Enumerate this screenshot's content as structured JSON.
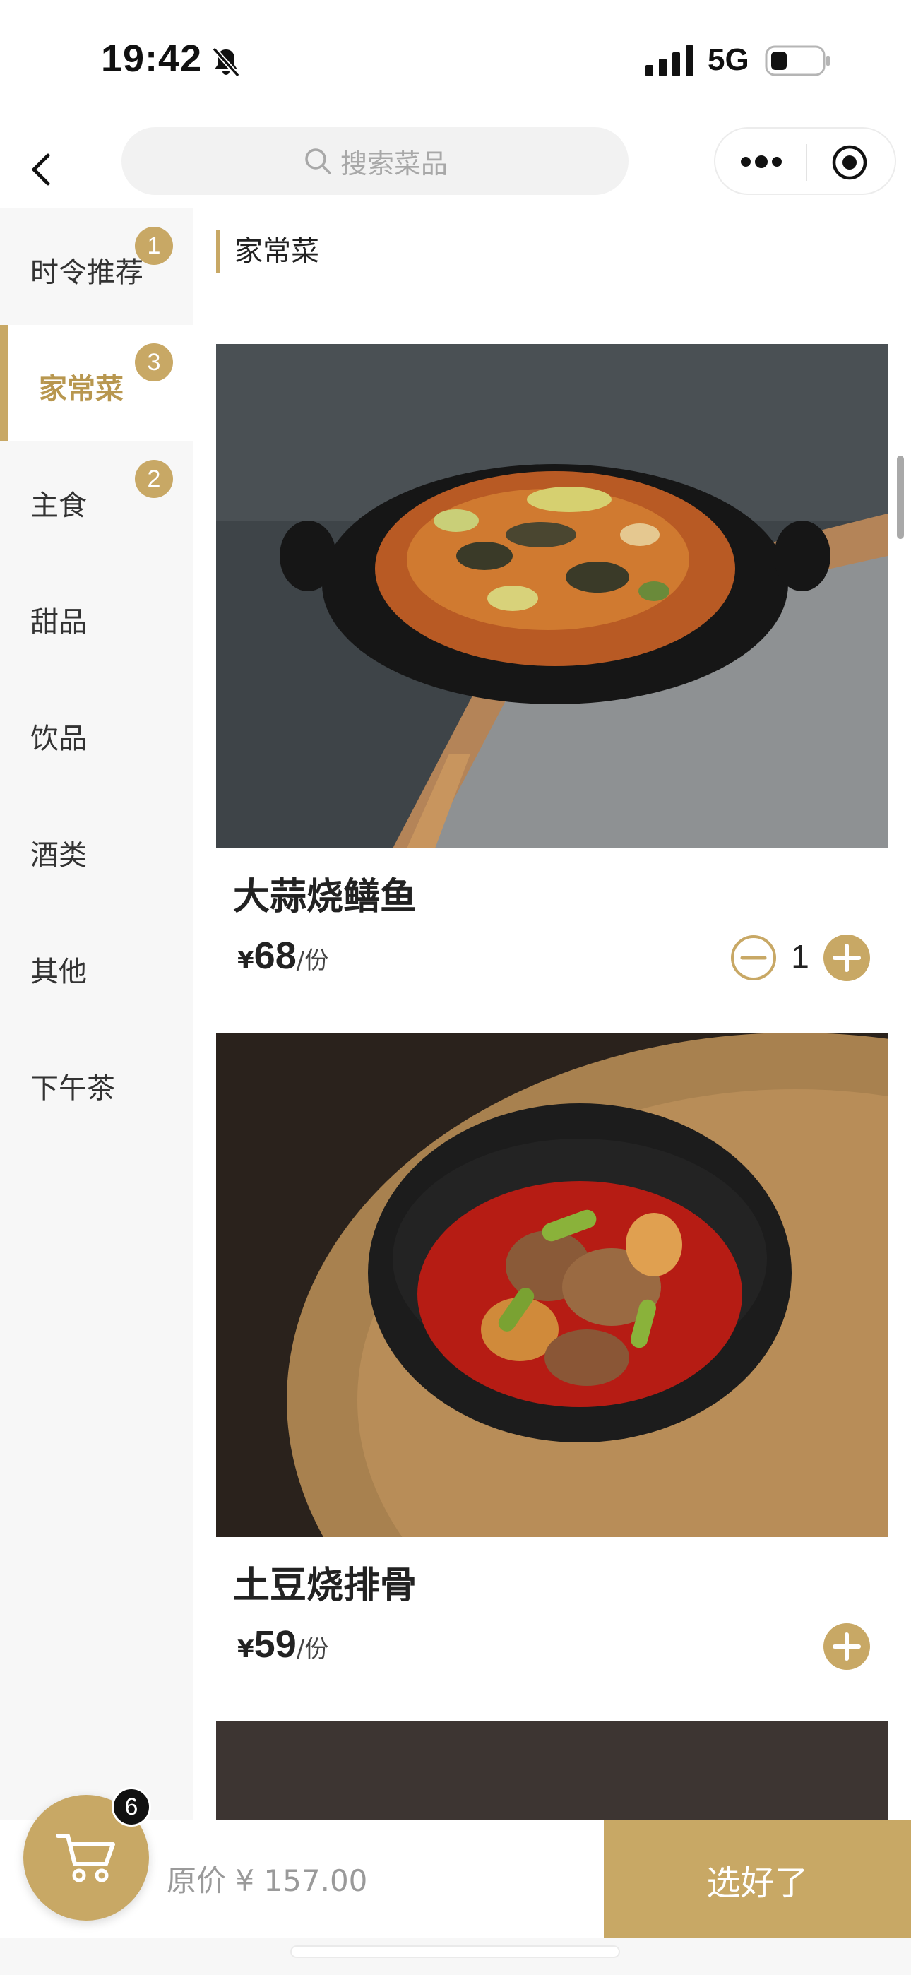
{
  "status_bar": {
    "time": "19:42",
    "network": "5G"
  },
  "nav": {
    "search_placeholder": "搜索菜品"
  },
  "sidebar": {
    "items": [
      {
        "label": "时令推荐",
        "badge": "1",
        "active": false
      },
      {
        "label": "家常菜",
        "badge": "3",
        "active": true
      },
      {
        "label": "主食",
        "badge": "2",
        "active": false
      },
      {
        "label": "甜品",
        "badge": "",
        "active": false
      },
      {
        "label": "饮品",
        "badge": "",
        "active": false
      },
      {
        "label": "酒类",
        "badge": "",
        "active": false
      },
      {
        "label": "其他",
        "badge": "",
        "active": false
      },
      {
        "label": "下午茶",
        "badge": "",
        "active": false
      }
    ]
  },
  "content": {
    "section_title": "家常菜",
    "dishes": [
      {
        "name": "大蒜烧鳝鱼",
        "currency": "¥",
        "price": "68",
        "unit": "/份",
        "quantity": "1"
      },
      {
        "name": "土豆烧排骨",
        "currency": "¥",
        "price": "59",
        "unit": "/份",
        "quantity": ""
      }
    ]
  },
  "cart": {
    "count": "6",
    "original_price": "原价 ¥ 157.00",
    "checkout_label": "选好了"
  },
  "colors": {
    "accent": "#c8a865",
    "accent_text": "#b8974f",
    "sidebar_bg": "#f7f7f7"
  },
  "icons": [
    "bell-slash-icon",
    "signal-icon",
    "battery-icon",
    "back-icon",
    "search-icon",
    "more-icon",
    "target-icon",
    "minus-icon",
    "plus-icon",
    "cart-icon"
  ]
}
